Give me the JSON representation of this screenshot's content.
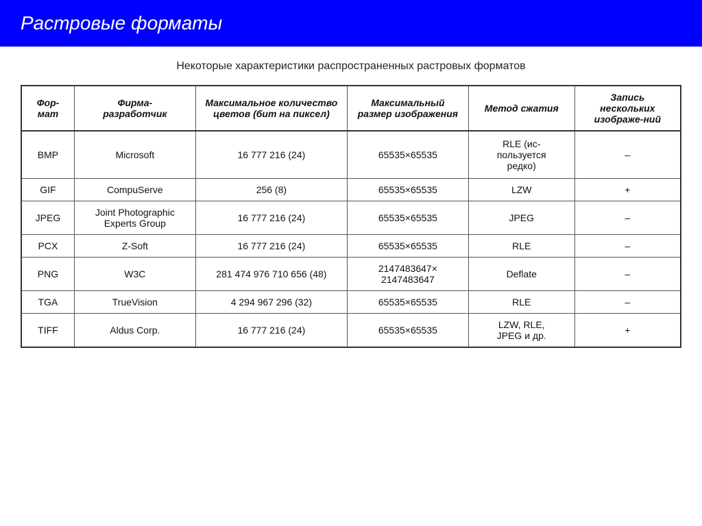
{
  "header": {
    "title": "Растровые форматы",
    "bg_color": "#0000ff",
    "text_color": "#ffffff"
  },
  "subtitle": "Некоторые характеристики распространенных растровых форматов",
  "table": {
    "columns": [
      {
        "id": "format",
        "label": "Фор-\nмат"
      },
      {
        "id": "company",
        "label": "Фирма-\nразработчик"
      },
      {
        "id": "colors",
        "label": "Максимальное количество цветов (бит на пиксел)"
      },
      {
        "id": "size",
        "label": "Максимальный размер изображения"
      },
      {
        "id": "method",
        "label": "Метод сжатия"
      },
      {
        "id": "multi",
        "label": "Запись нескольких изображе-ний"
      }
    ],
    "rows": [
      {
        "format": "BMP",
        "company": "Microsoft",
        "colors": "16 777 216 (24)",
        "size": "65535×65535",
        "method": "RLE (ис-\nпользуется\nредко)",
        "multi": "–"
      },
      {
        "format": "GIF",
        "company": "CompuServe",
        "colors": "256 (8)",
        "size": "65535×65535",
        "method": "LZW",
        "multi": "+"
      },
      {
        "format": "JPEG",
        "company": "Joint Photographic Experts Group",
        "colors": "16 777 216 (24)",
        "size": "65535×65535",
        "method": "JPEG",
        "multi": "–"
      },
      {
        "format": "PCX",
        "company": "Z-Soft",
        "colors": "16 777 216 (24)",
        "size": "65535×65535",
        "method": "RLE",
        "multi": "–"
      },
      {
        "format": "PNG",
        "company": "W3C",
        "colors": "281 474 976 710 656 (48)",
        "size": "2147483647×\n2147483647",
        "method": "Deflate",
        "multi": "–"
      },
      {
        "format": "TGA",
        "company": "TrueVision",
        "colors": "4 294 967 296 (32)",
        "size": "65535×65535",
        "method": "RLE",
        "multi": "–"
      },
      {
        "format": "TIFF",
        "company": "Aldus Corp.",
        "colors": "16 777 216 (24)",
        "size": "65535×65535",
        "method": "LZW, RLE,\nJPEG и др.",
        "multi": "+"
      }
    ]
  }
}
